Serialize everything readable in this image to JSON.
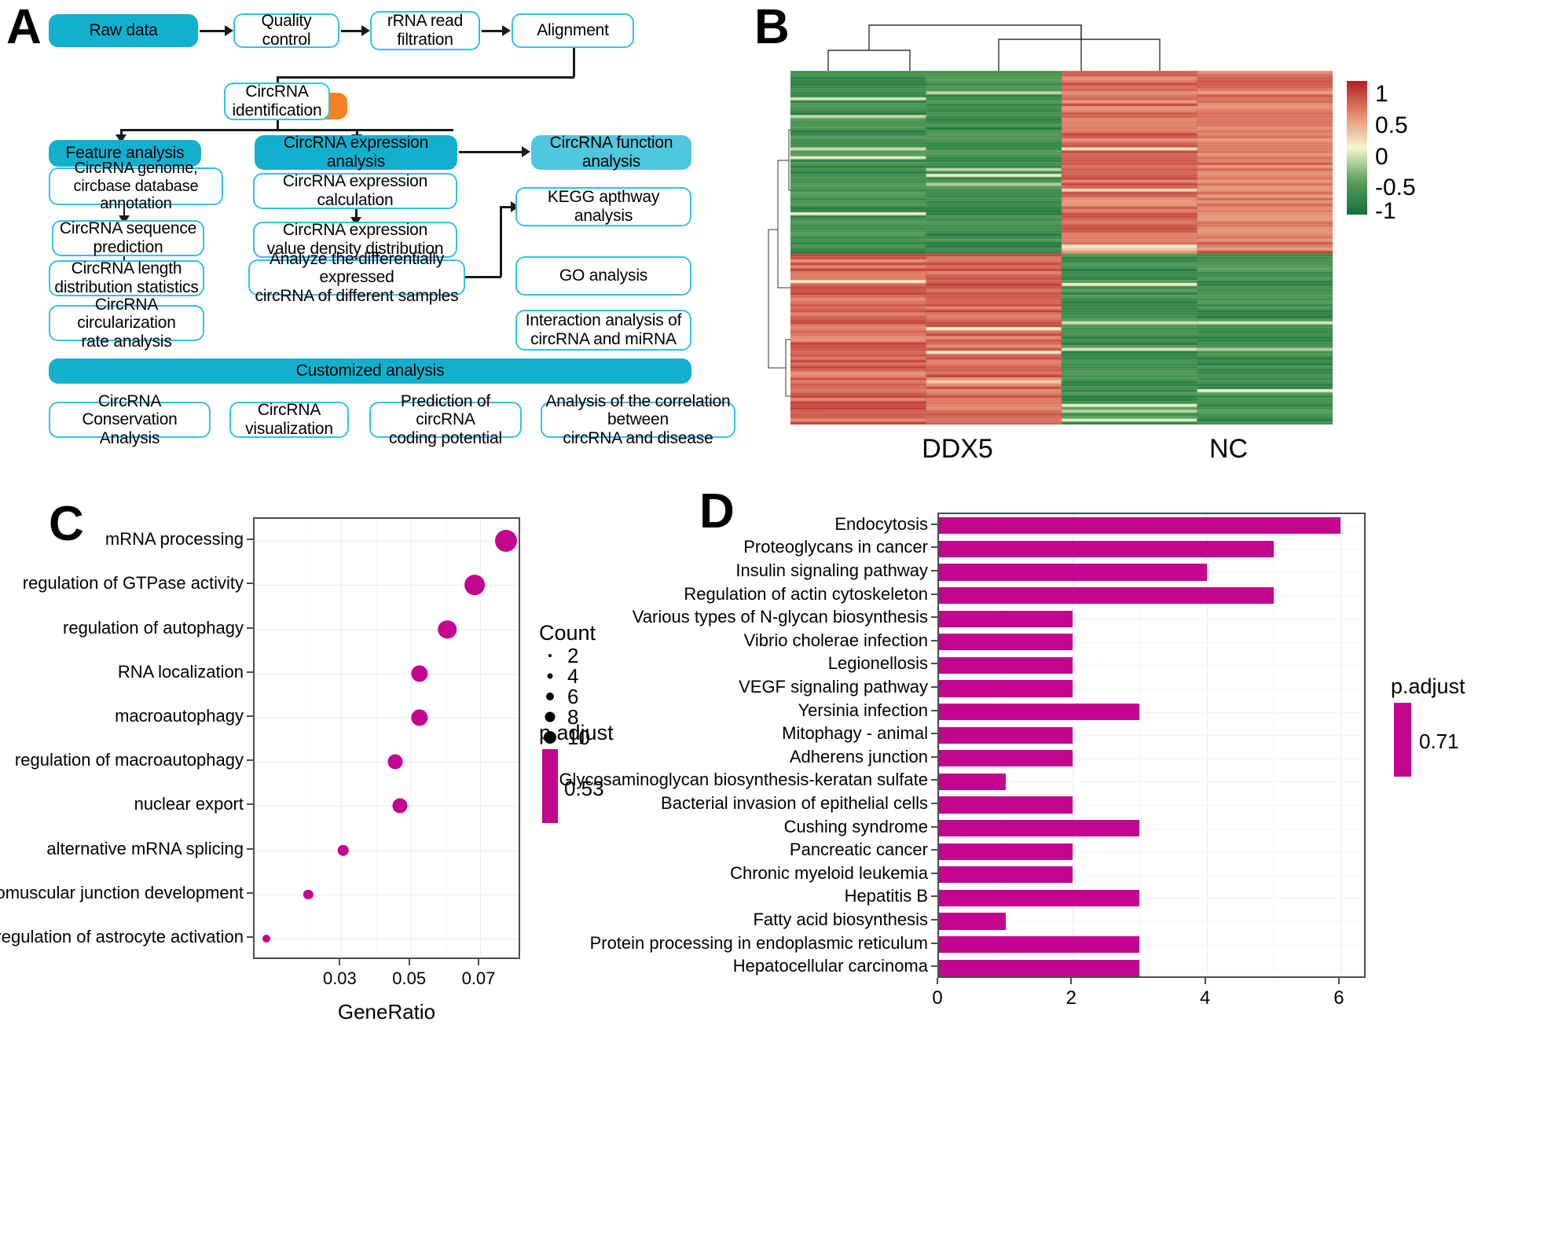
{
  "panels": {
    "a": {
      "letter": "A"
    },
    "b": {
      "letter": "B"
    },
    "c": {
      "letter": "C"
    },
    "d": {
      "letter": "D"
    }
  },
  "flowchart": {
    "row1": [
      {
        "label": "Raw data",
        "style": "teal"
      },
      {
        "label": "Quality control",
        "style": "white"
      },
      {
        "label": "rRNA read\nfiltration",
        "style": "white"
      },
      {
        "label": "Alignment",
        "style": "white"
      }
    ],
    "identification": {
      "label": "CircRNA\nidentification",
      "style": "white"
    },
    "headers": [
      {
        "label": "Feature analysis",
        "style": "teal"
      },
      {
        "label": "CircRNA expression\nanalysis",
        "style": "teal"
      },
      {
        "label": "CircRNA function\nanalysis",
        "style": "teal2"
      }
    ],
    "feature_column": [
      "CircRNA genome,\ncircbase database annotation",
      "CircRNA sequence\nprediction",
      "CircRNA length\ndistribution statistics",
      "CircRNA circularization\nrate analysis"
    ],
    "expression_column": [
      "CircRNA expression\ncalculation",
      "CircRNA expression\nvalue density distribution",
      "Analyze the differentially expressed\ncircRNA of different samples"
    ],
    "function_column": [
      "KEGG apthway\nanalysis",
      "GO analysis",
      "Interaction analysis of\ncircRNA and miRNA"
    ],
    "customized_banner": {
      "label": "Customized analysis",
      "style": "teal"
    },
    "customized_items": [
      "CircRNA Conservation\nAnalysis",
      "CircRNA\nvisualization",
      "Prediction of circRNA\ncoding potential",
      "Analysis of the correlation between\ncircRNA and disease"
    ],
    "colors": {
      "teal": "#13b0ce",
      "teal_light": "#4fc8de",
      "border": "#35c0e8",
      "orange": "#f58220"
    }
  },
  "heatmap": {
    "group_labels": [
      "DDX5",
      "NC"
    ],
    "colorbar_ticks": [
      "1",
      "0.5",
      "0",
      "-0.5",
      "-1"
    ],
    "colorbar_colors": {
      "high": "#b42025",
      "mid": "#f7f5d0",
      "low": "#15713a"
    },
    "n_columns": 4,
    "n_rows": 120
  },
  "chart_data": [
    {
      "panel": "C",
      "type": "scatter",
      "title": "",
      "xlabel": "GeneRatio",
      "ylabel": "",
      "xlim": [
        0.005,
        0.082
      ],
      "xticks": [
        0.03,
        0.05,
        0.07
      ],
      "xtick_labels": [
        "0.03",
        "0.05",
        "0.07"
      ],
      "categories": [
        "mRNA processing",
        "regulation of GTPase activity",
        "regulation of autophagy",
        "RNA localization",
        "macroautophagy",
        "regulation of macroautophagy",
        "nuclear export",
        "alternative mRNA splicing",
        "neuromuscular junction development",
        "regulation of astrocyte activation"
      ],
      "gene_ratio": [
        0.0775,
        0.0685,
        0.0605,
        0.0525,
        0.0525,
        0.0455,
        0.047,
        0.0305,
        0.0205,
        0.0085
      ],
      "count": [
        10,
        9,
        8,
        7,
        7,
        6,
        6,
        4,
        3,
        2
      ],
      "p_adjust": [
        0.53,
        0.53,
        0.53,
        0.53,
        0.53,
        0.53,
        0.53,
        0.53,
        0.53,
        0.53
      ],
      "legend": {
        "count_title": "Count",
        "count_values": [
          "2",
          "4",
          "6",
          "8",
          "10"
        ],
        "padjust_title": "p.adjust",
        "padjust_value": "0.53",
        "padjust_color": "#c3048e"
      },
      "grid": true,
      "legend_position": "right"
    },
    {
      "panel": "D",
      "type": "bar",
      "orientation": "horizontal",
      "title": "",
      "xlabel": "",
      "ylabel": "",
      "xlim": [
        0,
        6.4
      ],
      "xticks": [
        0,
        2,
        4,
        6
      ],
      "xtick_labels": [
        "0",
        "2",
        "4",
        "6"
      ],
      "categories": [
        "Endocytosis",
        "Proteoglycans in cancer",
        "Insulin signaling pathway",
        "Regulation of actin cytoskeleton",
        "Various types of N-glycan biosynthesis",
        "Vibrio cholerae infection",
        "Legionellosis",
        "VEGF signaling pathway",
        "Yersinia infection",
        "Mitophagy - animal",
        "Adherens junction",
        "Glycosaminoglycan biosynthesis-keratan sulfate",
        "Bacterial invasion of epithelial cells",
        "Cushing syndrome",
        "Pancreatic cancer",
        "Chronic myeloid leukemia",
        "Hepatitis B",
        "Fatty acid biosynthesis",
        "Protein processing in endoplasmic reticulum",
        "Hepatocellular carcinoma"
      ],
      "values": [
        6,
        5,
        4,
        5,
        2,
        2,
        2,
        2,
        3,
        2,
        2,
        1,
        2,
        3,
        2,
        2,
        3,
        1,
        3,
        3
      ],
      "bar_color": "#c3048e",
      "legend": {
        "padjust_title": "p.adjust",
        "padjust_value": "0.71",
        "padjust_color": "#c3048e"
      },
      "grid": true,
      "legend_position": "right"
    }
  ]
}
